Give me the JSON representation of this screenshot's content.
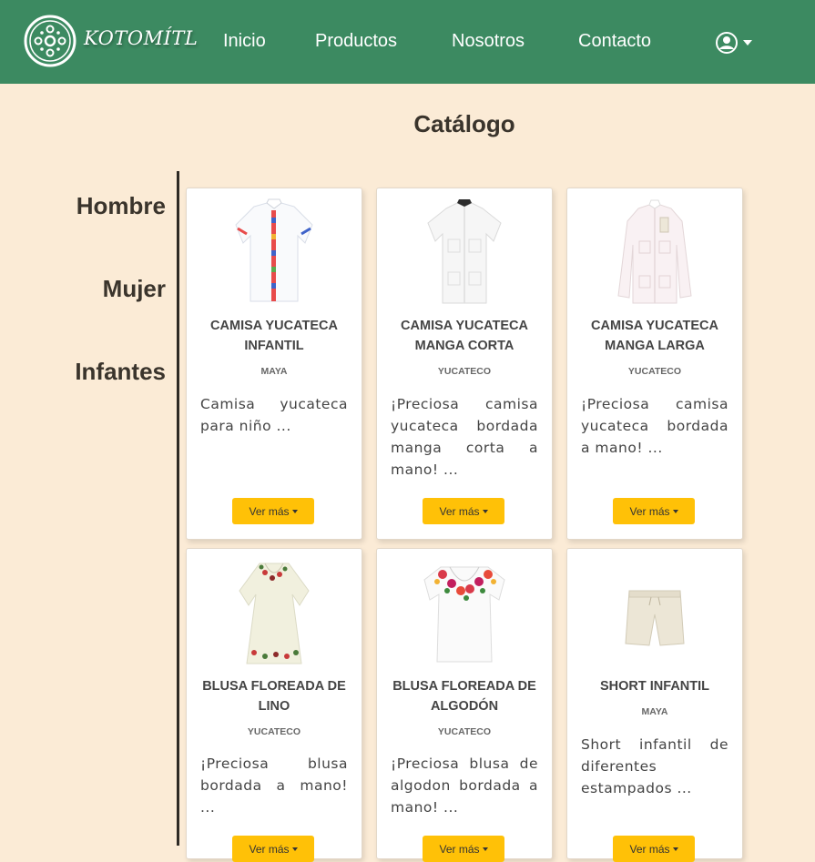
{
  "brand": "KOTOMÍTL",
  "nav": {
    "inicio": "Inicio",
    "productos": "Productos",
    "nosotros": "Nosotros",
    "contacto": "Contacto"
  },
  "page_title": "Catálogo",
  "categories": [
    "Hombre",
    "Mujer",
    "Infantes"
  ],
  "more_label": "Ver más",
  "colors": {
    "navbar": "#3C8A61",
    "background": "#FBEBD6",
    "button": "#FFC107"
  },
  "products": [
    {
      "title": "CAMISA YUCATECA INFANTIL",
      "brand": "MAYA",
      "description": "Camisa yucateca para niño ...",
      "icon": "embroidered-boys-shirt-image"
    },
    {
      "title": "CAMISA YUCATECA MANGA CORTA",
      "brand": "YUCATECO",
      "description": "¡Preciosa camisa yucateca bordada manga corta a mano! ...",
      "icon": "short-sleeve-guayabera-image"
    },
    {
      "title": "CAMISA YUCATECA MANGA LARGA",
      "brand": "YUCATECO",
      "description": "¡Preciosa camisa yucateca bordada a mano! ...",
      "icon": "long-sleeve-guayabera-image"
    },
    {
      "title": "BLUSA FLOREADA DE LINO",
      "brand": "YUCATECO",
      "description": "¡Preciosa blusa bordada a mano! ...",
      "icon": "linen-floral-dress-image"
    },
    {
      "title": "BLUSA FLOREADA DE ALGODÓN",
      "brand": "YUCATECO",
      "description": "¡Preciosa blusa de algodon bordada a mano! ...",
      "icon": "cotton-floral-blouse-image"
    },
    {
      "title": "SHORT INFANTIL",
      "brand": "MAYA",
      "description": "Short infantil de diferentes estampados ...",
      "icon": "kids-shorts-image"
    }
  ]
}
